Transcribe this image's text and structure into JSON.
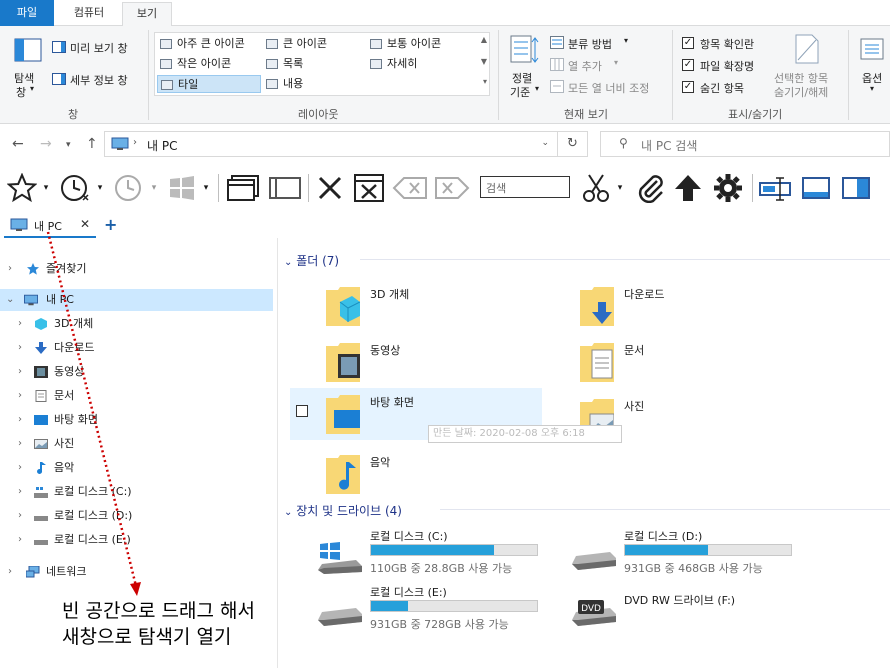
{
  "ribbon_tabs": {
    "file": "파일",
    "computer": "컴퓨터",
    "view": "보기"
  },
  "ribbon": {
    "pane": {
      "nav_pane_line1": "탐색",
      "nav_pane_line2": "창",
      "preview_pane": "미리 보기 창",
      "details_pane": "세부 정보 창",
      "group_label": "창"
    },
    "layout": {
      "items": [
        "아주 큰 아이콘",
        "큰 아이콘",
        "보통 아이콘",
        "작은 아이콘",
        "목록",
        "자세히",
        "타일",
        "내용"
      ],
      "selected": "타일",
      "group_label": "레이아웃"
    },
    "current_view": {
      "sort_line1": "정렬",
      "sort_line2": "기준",
      "group_by": "분류 방법",
      "add_columns": "열 추가",
      "size_all_columns": "모든 열 너비 조정",
      "group_label": "현재 보기"
    },
    "show_hide": {
      "item_checkboxes": "항목 확인란",
      "file_extensions": "파일 확장명",
      "hidden_items": "숨긴 항목",
      "hide_selected_line1": "선택한 항목",
      "hide_selected_line2": "숨기기/해제",
      "group_label": "표시/숨기기"
    },
    "options_label": "옵션"
  },
  "address": {
    "path": "내 PC",
    "search_placeholder": "내 PC 검색"
  },
  "toolbar": {
    "search_placeholder": "검색"
  },
  "doc_tab": {
    "label": "내 PC"
  },
  "tree": {
    "quick_access": "즐겨찾기",
    "this_pc": "내 PC",
    "children": [
      "3D 개체",
      "다운로드",
      "동영상",
      "문서",
      "바탕 화면",
      "사진",
      "음악",
      "로컬 디스크 (C:)",
      "로컬 디스크 (D:)",
      "로컬 디스크 (E:)"
    ],
    "network": "네트워크"
  },
  "content": {
    "folders_header": "폴더 (7)",
    "folders": [
      "3D 개체",
      "다운로드",
      "동영상",
      "문서",
      "바탕 화면",
      "사진",
      "음악"
    ],
    "tooltip": "만든 날짜: 2020-02-08 오후 6:18",
    "drives_header": "장치 및 드라이브 (4)",
    "drives": [
      {
        "name": "로컬 디스크 (C:)",
        "free": "110GB 중 28.8GB 사용 가능",
        "used_fraction": 0.74
      },
      {
        "name": "로컬 디스크 (D:)",
        "free": "931GB 중 468GB 사용 가능",
        "used_fraction": 0.5
      },
      {
        "name": "로컬 디스크 (E:)",
        "free": "931GB 중 728GB 사용 가능",
        "used_fraction": 0.22
      },
      {
        "name": "DVD RW 드라이브 (F:)",
        "free": ""
      }
    ]
  },
  "annotation": {
    "line1": "빈 공간으로 드래그 해서",
    "line2": "새창으로 탐색기 열기"
  },
  "colors": {
    "accent": "#1979ca",
    "drive_bar": "#26a0da",
    "selection": "#cce8ff",
    "folder": "#f8d775",
    "annotation_arrow": "#cc0000"
  }
}
